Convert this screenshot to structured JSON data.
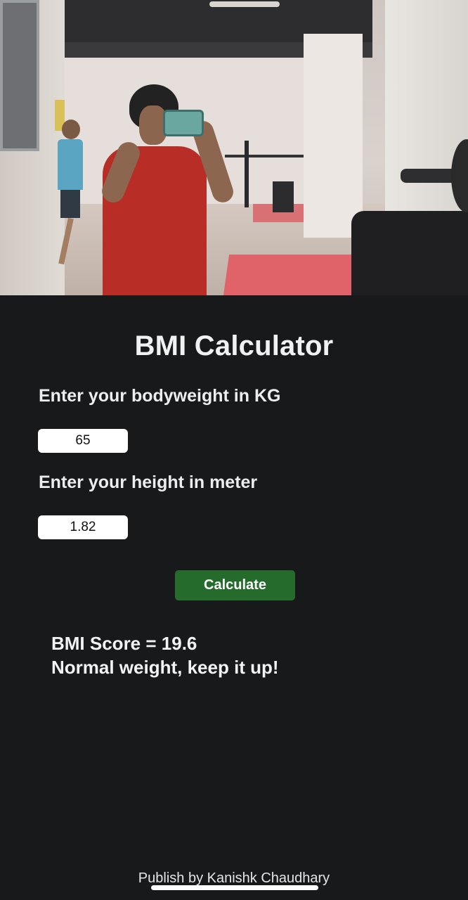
{
  "hero": {
    "photo_description_icon": "gym-mirror-selfie-photo"
  },
  "title": "BMI Calculator",
  "weight": {
    "label": "Enter your bodyweight in KG",
    "value": "65"
  },
  "height": {
    "label": "Enter your height in meter",
    "value": "1.82"
  },
  "button": {
    "label": "Calculate"
  },
  "result": {
    "score_line": "BMI Score = 19.6",
    "message": "Normal weight, keep it up!"
  },
  "footer": {
    "text": "Publish by Kanishk Chaudhary"
  },
  "colors": {
    "background": "#18191b",
    "button": "#256b2c",
    "text": "#f1f1f1"
  }
}
